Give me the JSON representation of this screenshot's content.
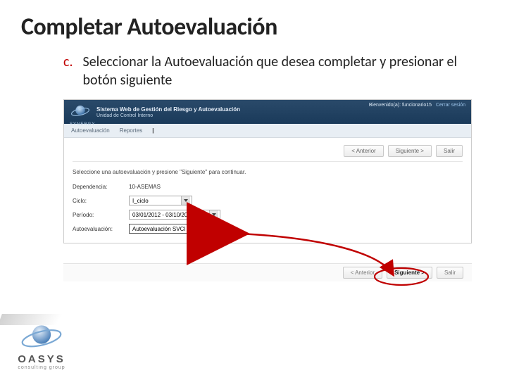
{
  "slide": {
    "title": "Completar Autoevaluación",
    "step_letter": "c.",
    "step_text": "Seleccionar la Autoevaluación que desea completar y presionar el botón siguiente"
  },
  "app": {
    "brand": "SYNERGY",
    "title1": "Sistema Web de Gestión del Riesgo y Autoevaluación",
    "title2": "Unidad de Control Interno",
    "welcome": "Bienvenido(a): funcionario15",
    "logout": "Cerrar sesión",
    "nav": {
      "item1": "Autoevaluación",
      "item2": "Reportes"
    },
    "wizard": {
      "prev": "< Anterior",
      "next": "Siguiente >",
      "exit": "Salir"
    },
    "instruction": "Seleccione una autoevaluación y presione \"Siguiente\" para continuar.",
    "form": {
      "dependencia_label": "Dependencia:",
      "dependencia_value": "10-ASEMAS",
      "ciclo_label": "Ciclo:",
      "ciclo_value": "I_ciclo",
      "periodo_label": "Período:",
      "periodo_value": "03/01/2012 - 03/10/2012",
      "autoeval_label": "Autoevaluación:",
      "autoeval_value": "Autoevaluación SVCI 2012"
    },
    "bottom": {
      "prev": "< Anterior",
      "next": "Siguiente >",
      "exit": "Salir"
    }
  },
  "footer": {
    "name": "OASYS",
    "sub": "consulting group"
  }
}
